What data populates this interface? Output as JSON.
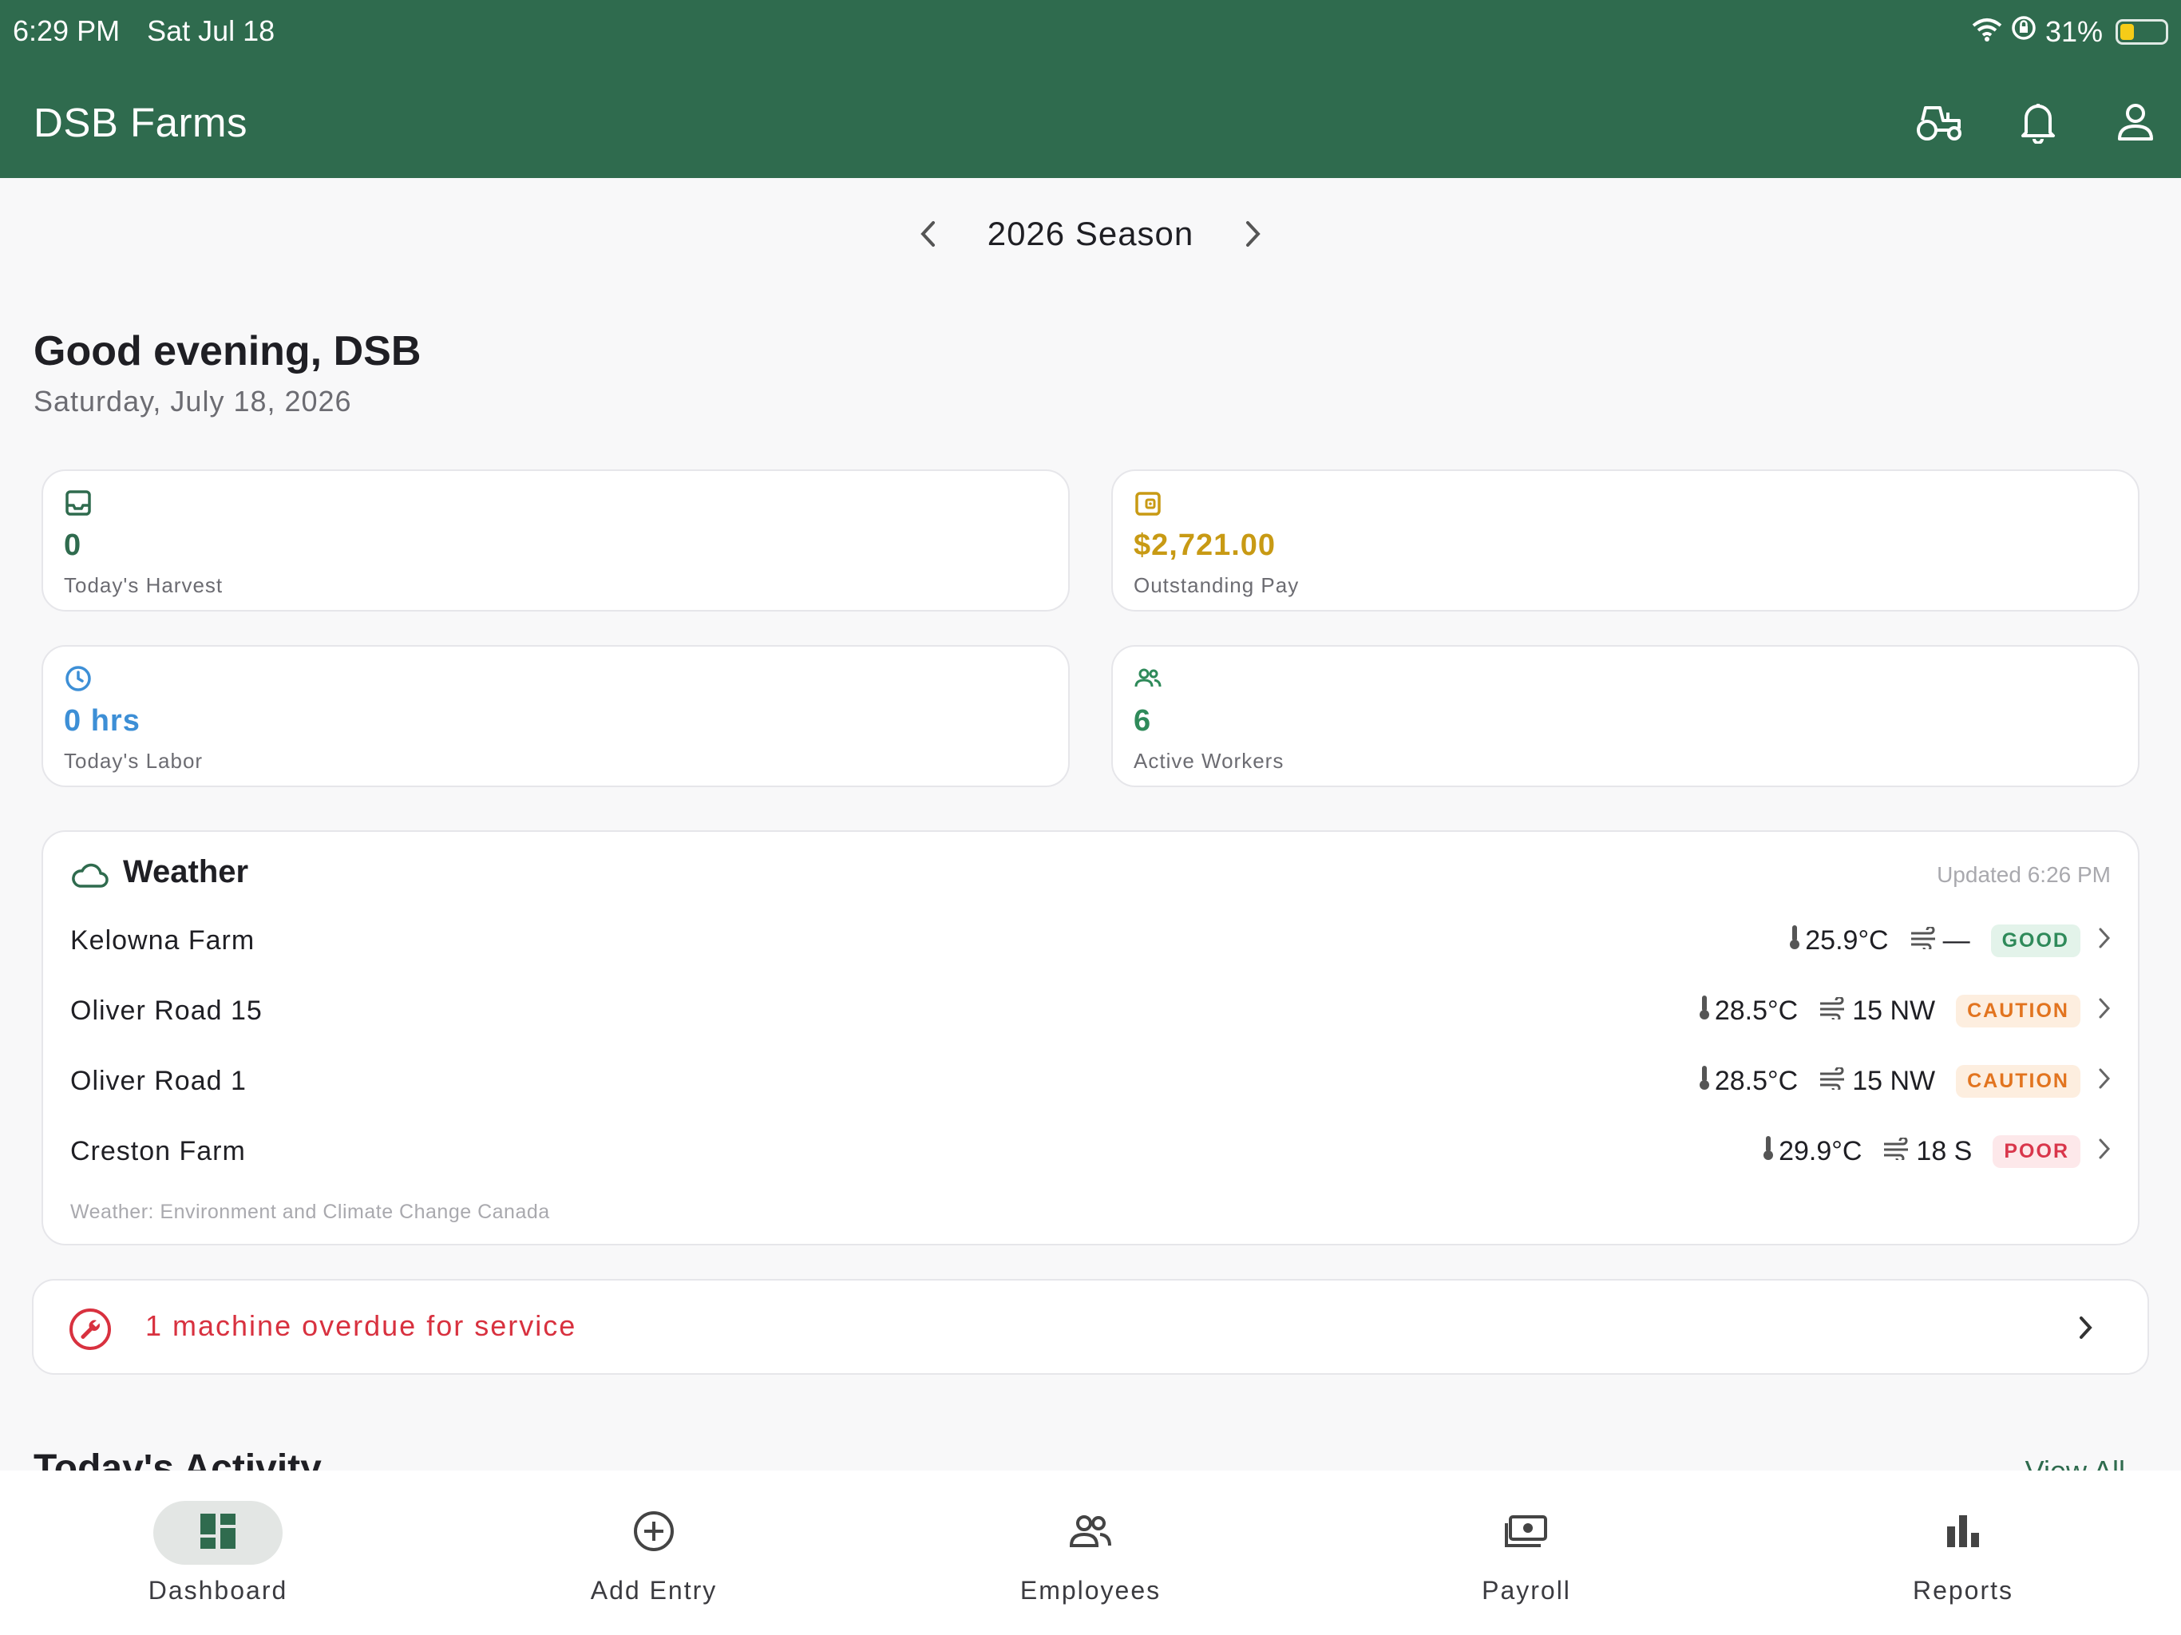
{
  "status_bar": {
    "time": "6:29 PM",
    "date": "Sat Jul 18",
    "battery": "31%",
    "battery_level": 0.31
  },
  "header": {
    "title": "DSB Farms",
    "icons": [
      "tractor-icon",
      "bell-icon",
      "profile-icon"
    ]
  },
  "season": {
    "label": "2026 Season"
  },
  "greeting": {
    "title": "Good evening, DSB",
    "date": "Saturday, July 18, 2026"
  },
  "stats": [
    {
      "value": "0",
      "label": "Today's Harvest",
      "icon": "inbox-icon",
      "color": "#2f6b4e"
    },
    {
      "value": "$2,721.00",
      "label": "Outstanding Pay",
      "icon": "wallet-icon",
      "color": "#c89a14"
    },
    {
      "value": "0 hrs",
      "label": "Today's Labor",
      "icon": "clock-icon",
      "color": "#3d8fd6"
    },
    {
      "value": "6",
      "label": "Active Workers",
      "icon": "people-icon",
      "color": "#2f8a5a"
    }
  ],
  "weather": {
    "title": "Weather",
    "updated": "Updated 6:26 PM",
    "rows": [
      {
        "name": "Kelowna Farm",
        "temp": "25.9°C",
        "wind": "—",
        "status": "GOOD"
      },
      {
        "name": "Oliver Road 15",
        "temp": "28.5°C",
        "wind": "15 NW",
        "status": "CAUTION"
      },
      {
        "name": "Oliver Road 1",
        "temp": "28.5°C",
        "wind": "15 NW",
        "status": "CAUTION"
      },
      {
        "name": "Creston Farm",
        "temp": "29.9°C",
        "wind": "18 S",
        "status": "POOR"
      }
    ],
    "source": "Weather: Environment and Climate Change Canada"
  },
  "alert": {
    "text": "1 machine overdue for service"
  },
  "activity": {
    "title": "Today's Activity",
    "view_all": "View All"
  },
  "tabs": [
    {
      "label": "Dashboard",
      "icon": "dashboard-icon",
      "active": true
    },
    {
      "label": "Add Entry",
      "icon": "add-circle-icon",
      "active": false
    },
    {
      "label": "Employees",
      "icon": "employees-icon",
      "active": false
    },
    {
      "label": "Payroll",
      "icon": "payroll-icon",
      "active": false
    },
    {
      "label": "Reports",
      "icon": "reports-icon",
      "active": false
    }
  ],
  "colors": {
    "brand": "#2f6b4e",
    "danger": "#d8313f",
    "good": "#2f8a5a",
    "caution": "#e2741f"
  }
}
